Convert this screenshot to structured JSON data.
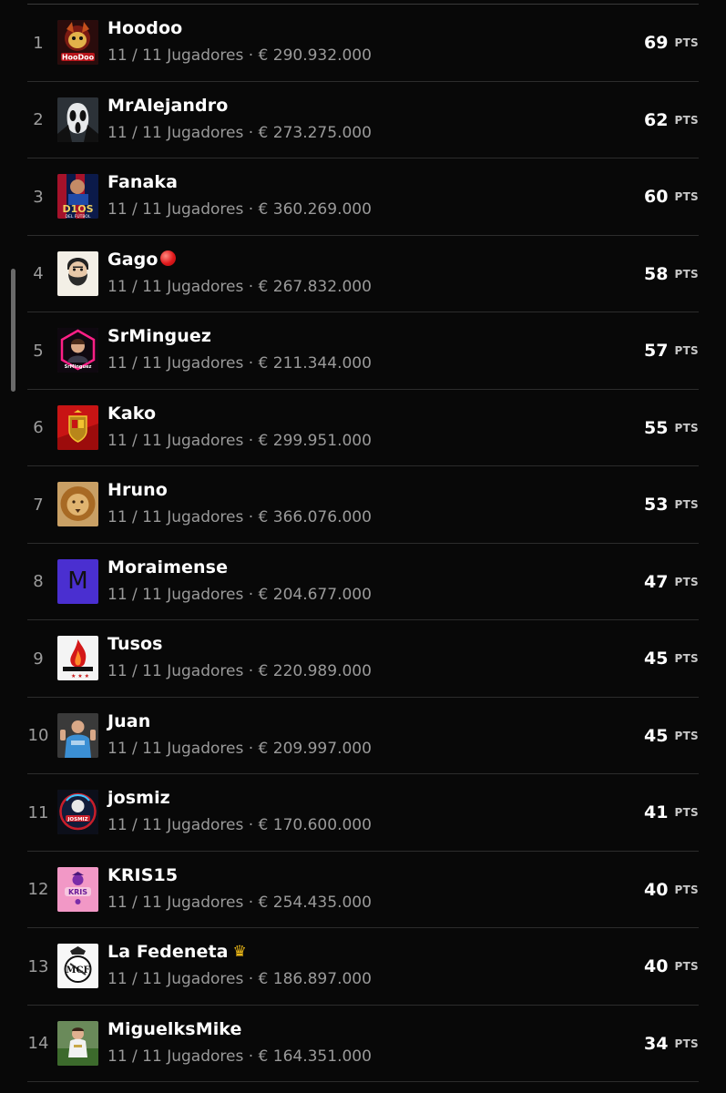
{
  "sub_separator": " · ",
  "pts_unit": "PTS",
  "players": [
    {
      "rank": "1",
      "name": "Hoodoo",
      "squad": "11 / 11 Jugadores",
      "value": "€ 290.932.000",
      "points": "69",
      "avatar": "hoodoo-fox-avatar"
    },
    {
      "rank": "2",
      "name": "MrAlejandro",
      "squad": "11 / 11 Jugadores",
      "value": "€ 273.275.000",
      "points": "62",
      "avatar": "ghostface-mask-avatar"
    },
    {
      "rank": "3",
      "name": "Fanaka",
      "squad": "11 / 11 Jugadores",
      "value": "€ 360.269.000",
      "points": "60",
      "avatar": "dios-del-futbol-avatar"
    },
    {
      "rank": "4",
      "name": "Gago",
      "badge": "red-circle-emoji",
      "squad": "11 / 11 Jugadores",
      "value": "€ 267.832.000",
      "points": "58",
      "avatar": "bearded-man-cartoon-avatar"
    },
    {
      "rank": "5",
      "name": "SrMinguez",
      "squad": "11 / 11 Jugadores",
      "value": "€ 211.344.000",
      "points": "57",
      "avatar": "neon-portrait-avatar"
    },
    {
      "rank": "6",
      "name": "Kako",
      "squad": "11 / 11 Jugadores",
      "value": "€ 299.951.000",
      "points": "55",
      "avatar": "spain-crest-avatar"
    },
    {
      "rank": "7",
      "name": "Hruno",
      "squad": "11 / 11 Jugadores",
      "value": "€ 366.076.000",
      "points": "53",
      "avatar": "lion-avatar"
    },
    {
      "rank": "8",
      "name": "Moraimense",
      "squad": "11 / 11 Jugadores",
      "value": "€ 204.677.000",
      "points": "47",
      "avatar": "letter-m-avatar",
      "avatar_letter": "M",
      "avatar_color": "#4a2fd0"
    },
    {
      "rank": "9",
      "name": "Tusos",
      "squad": "11 / 11 Jugadores",
      "value": "€ 220.989.000",
      "points": "45",
      "avatar": "flame-crest-avatar"
    },
    {
      "rank": "10",
      "name": "Juan",
      "squad": "11 / 11 Jugadores",
      "value": "€ 209.997.000",
      "points": "45",
      "avatar": "player-photo-avatar"
    },
    {
      "rank": "11",
      "name": "josmiz",
      "squad": "11 / 11 Jugadores",
      "value": "€ 170.600.000",
      "points": "41",
      "avatar": "josmiz-logo-avatar"
    },
    {
      "rank": "12",
      "name": "KRIS15",
      "squad": "11 / 11 Jugadores",
      "value": "€ 254.435.000",
      "points": "40",
      "avatar": "kris-pink-logo-avatar"
    },
    {
      "rank": "13",
      "name": "La Fedeneta",
      "badge": "crown-emoji",
      "squad": "11 / 11 Jugadores",
      "value": "€ 186.897.000",
      "points": "40",
      "avatar": "real-madrid-crest-avatar"
    },
    {
      "rank": "14",
      "name": "MiguelksMike",
      "squad": "11 / 11 Jugadores",
      "value": "€ 164.351.000",
      "points": "34",
      "avatar": "child-player-photo-avatar"
    }
  ]
}
